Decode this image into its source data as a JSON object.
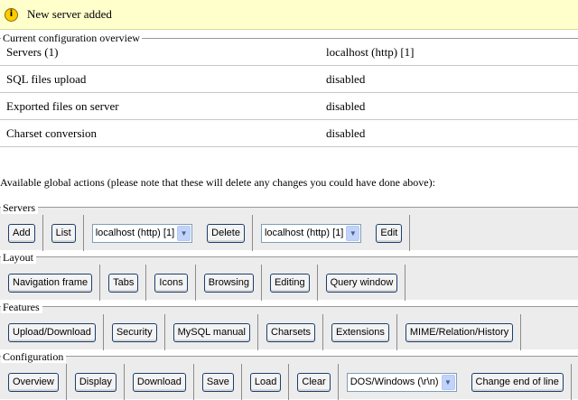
{
  "notice": {
    "icon": "info-icon",
    "text": "New server added"
  },
  "overview": {
    "legend": "Current configuration overview",
    "rows": [
      {
        "name": "Servers (1)",
        "value": "localhost (http) [1]"
      },
      {
        "name": "SQL files upload",
        "value": "disabled"
      },
      {
        "name": "Exported files on server",
        "value": "disabled"
      },
      {
        "name": "Charset conversion",
        "value": "disabled"
      }
    ]
  },
  "actions_label": "Available global actions (please note that these will delete any changes you could have done above):",
  "servers": {
    "legend": "Servers",
    "add": "Add",
    "list": "List",
    "select1": "localhost (http) [1]",
    "delete": "Delete",
    "select2": "localhost (http) [1]",
    "edit": "Edit"
  },
  "layout": {
    "legend": "Layout",
    "navigation_frame": "Navigation frame",
    "tabs": "Tabs",
    "icons": "Icons",
    "browsing": "Browsing",
    "editing": "Editing",
    "query_window": "Query window"
  },
  "features": {
    "legend": "Features",
    "upload_download": "Upload/Download",
    "security": "Security",
    "mysql_manual": "MySQL manual",
    "charsets": "Charsets",
    "extensions": "Extensions",
    "mime_relation_history": "MIME/Relation/History"
  },
  "configuration": {
    "legend": "Configuration",
    "overview": "Overview",
    "display": "Display",
    "download": "Download",
    "save": "Save",
    "load": "Load",
    "clear": "Clear",
    "eol_select": "DOS/Windows (\\r\\n)",
    "change_eol": "Change end of line"
  },
  "colors": {
    "notice_bg": "#ffffcc",
    "group_bg": "#ececec",
    "button_border": "#1c3f6e"
  }
}
